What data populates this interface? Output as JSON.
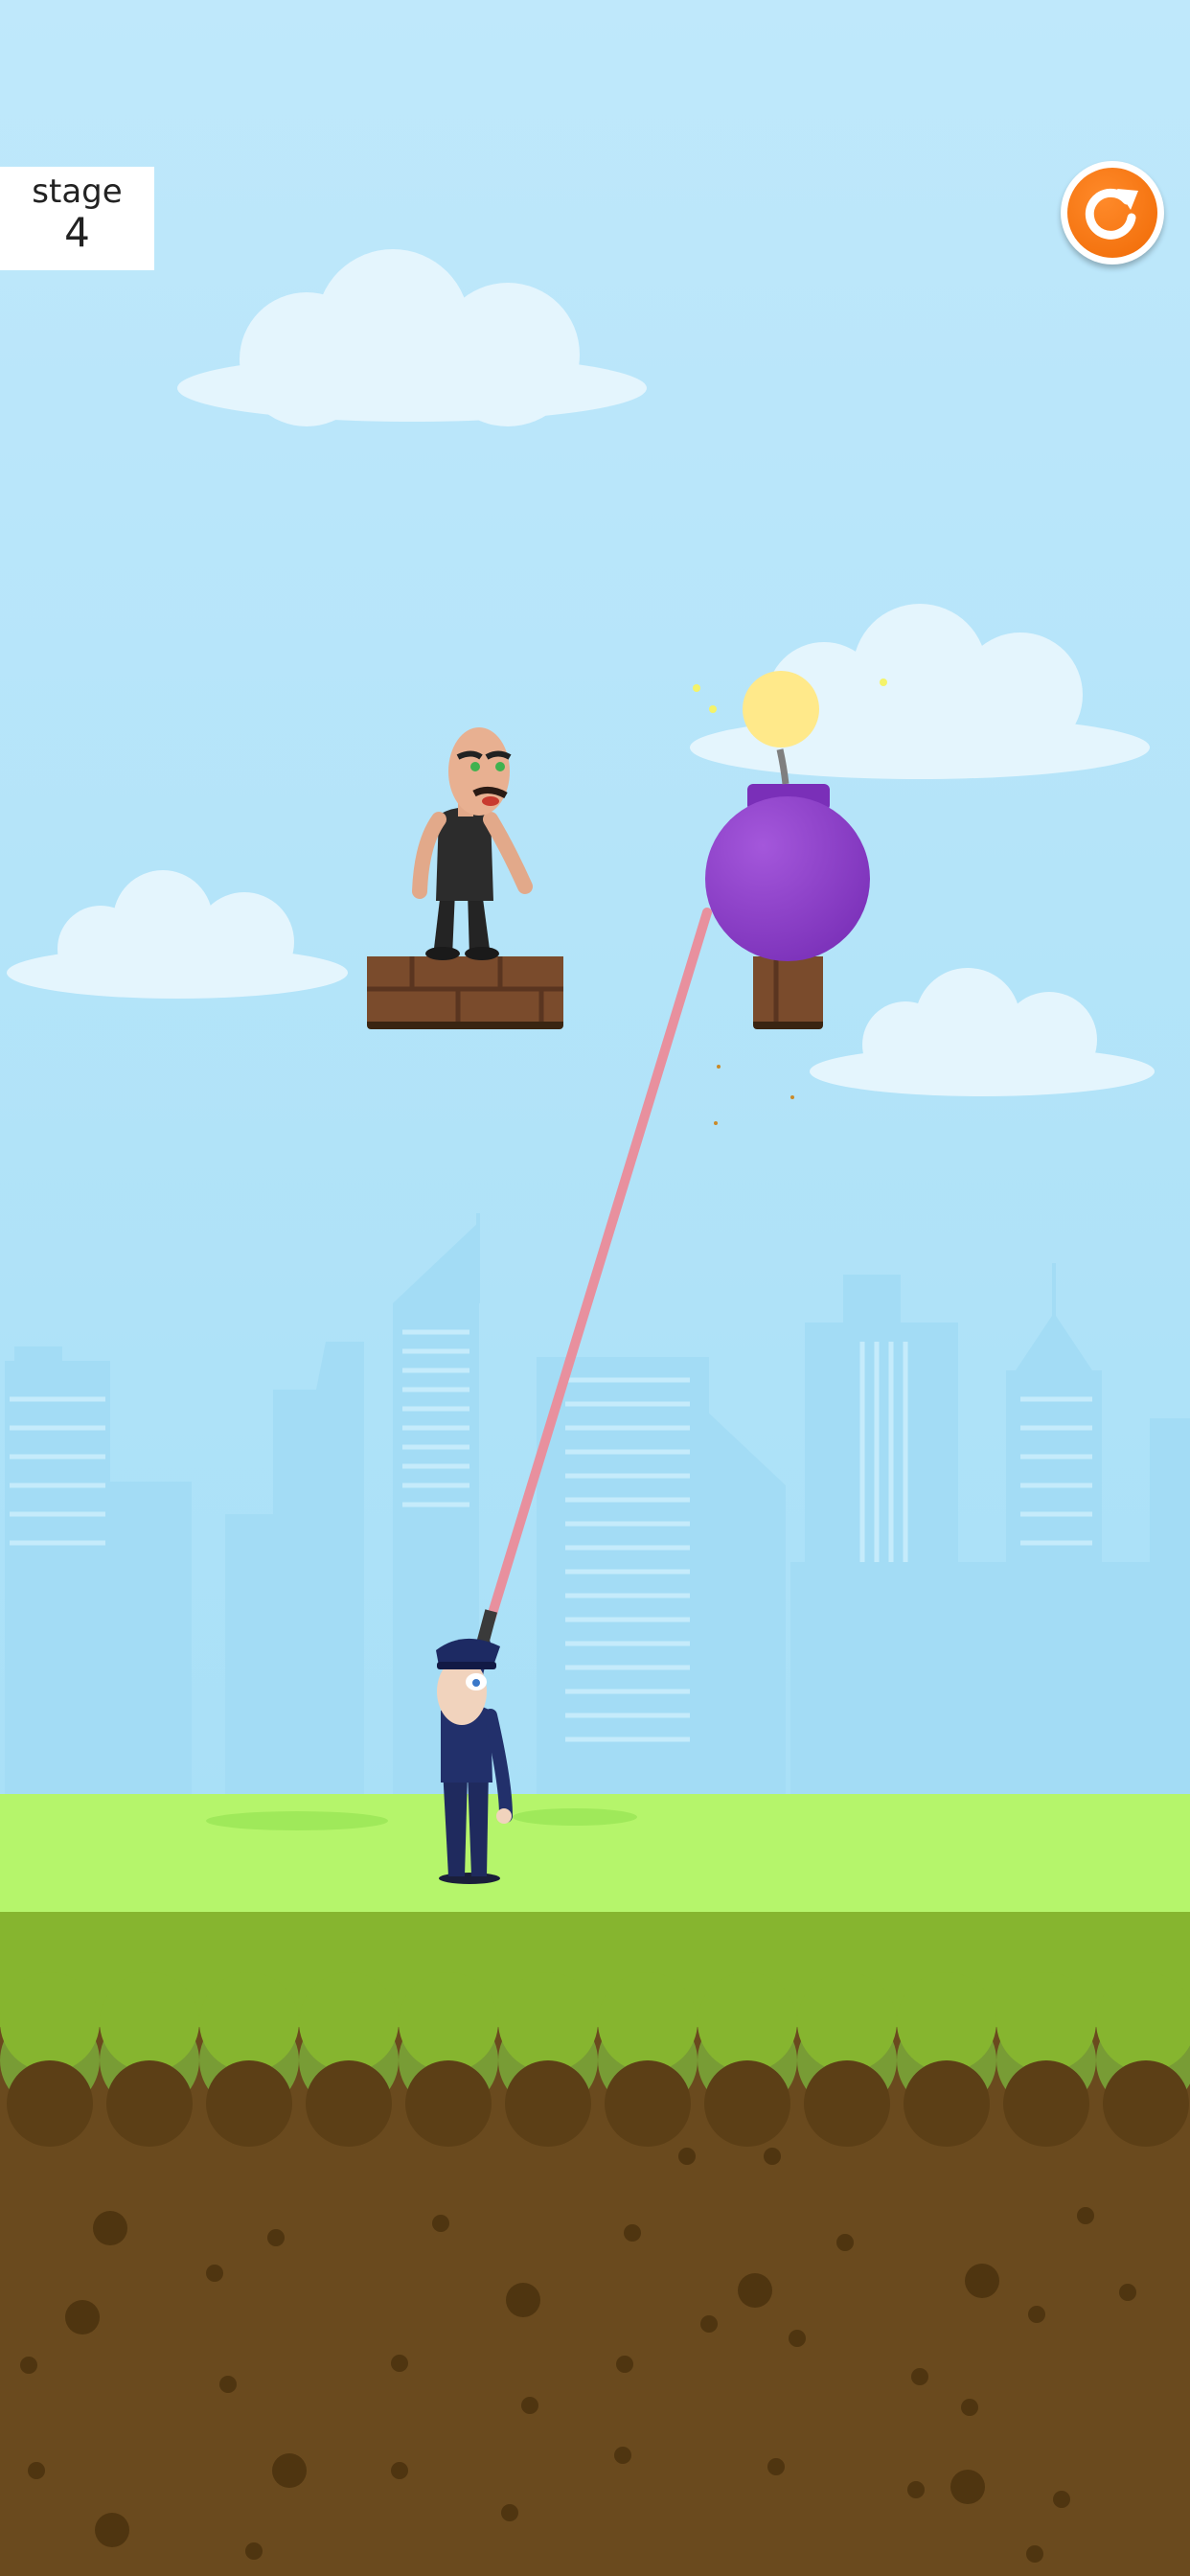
{
  "hud": {
    "stage_label": "stage",
    "stage_number": "4"
  },
  "icons": {
    "restart": "restart-icon"
  },
  "colors": {
    "sky": "#b9e6fa",
    "grass": "#b5f56b",
    "dirt": "#6a4a1e",
    "bomb": "#8a3ec9",
    "laser": "#e8909e",
    "restart_button": "#f26f0a"
  }
}
